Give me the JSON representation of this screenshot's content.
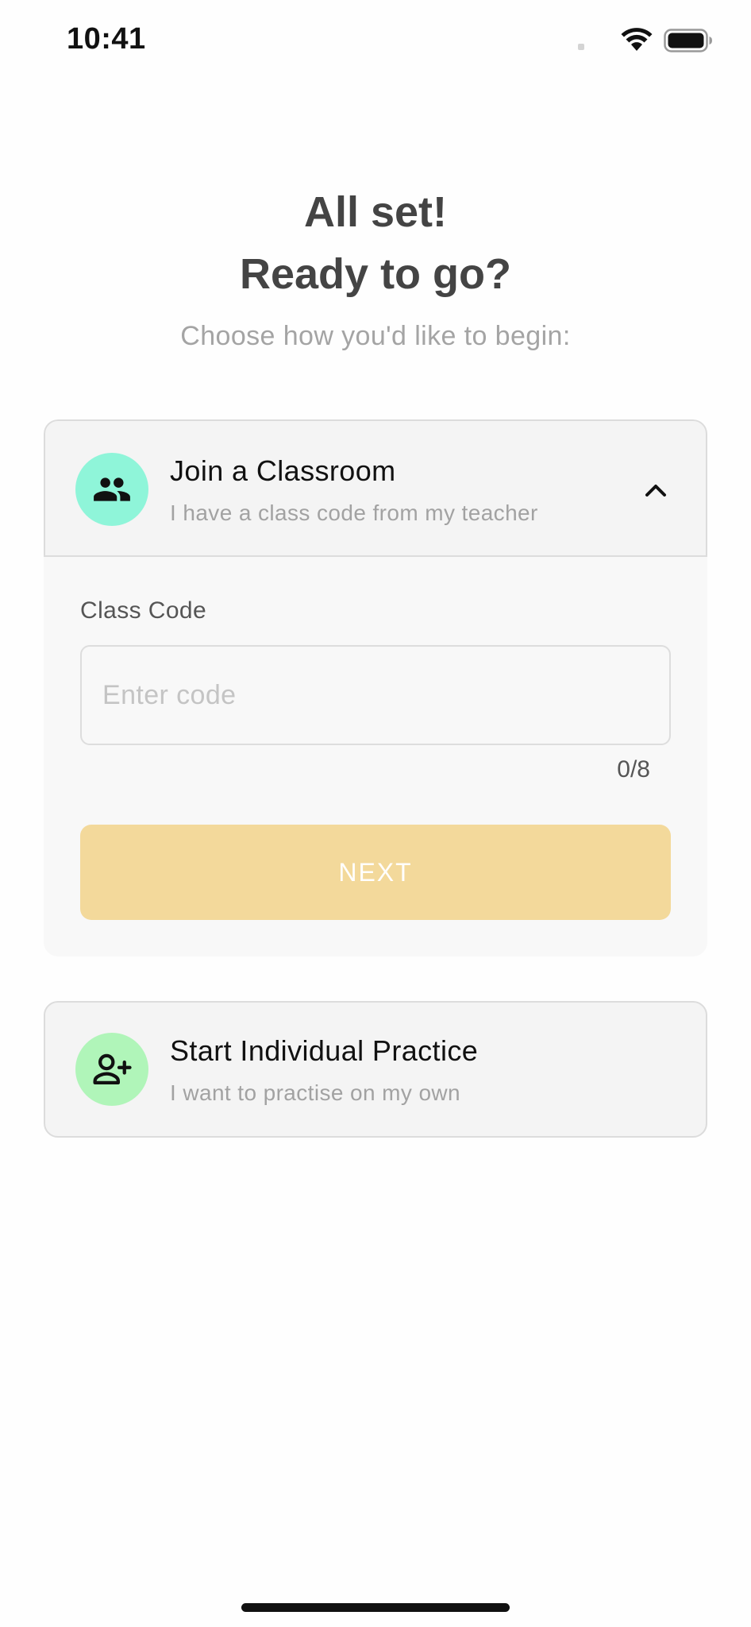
{
  "status_bar": {
    "time": "10:41"
  },
  "header": {
    "line1": "All set!",
    "line2": "Ready to go?",
    "subtitle": "Choose how you'd like to begin:"
  },
  "classroom_option": {
    "title": "Join a Classroom",
    "subtitle": "I have a class code from my teacher",
    "icon": "group-icon",
    "icon_bg_color": "#8ff5d9",
    "expanded": true,
    "field_label": "Class Code",
    "input_value": "",
    "input_placeholder": "Enter code",
    "counter": "0/8",
    "next_label": "NEXT",
    "next_color": "#f3d99b"
  },
  "individual_option": {
    "title": "Start Individual Practice",
    "subtitle": "I want to practise on my own",
    "icon": "person-add-icon",
    "icon_bg_color": "#b0f5b9"
  }
}
